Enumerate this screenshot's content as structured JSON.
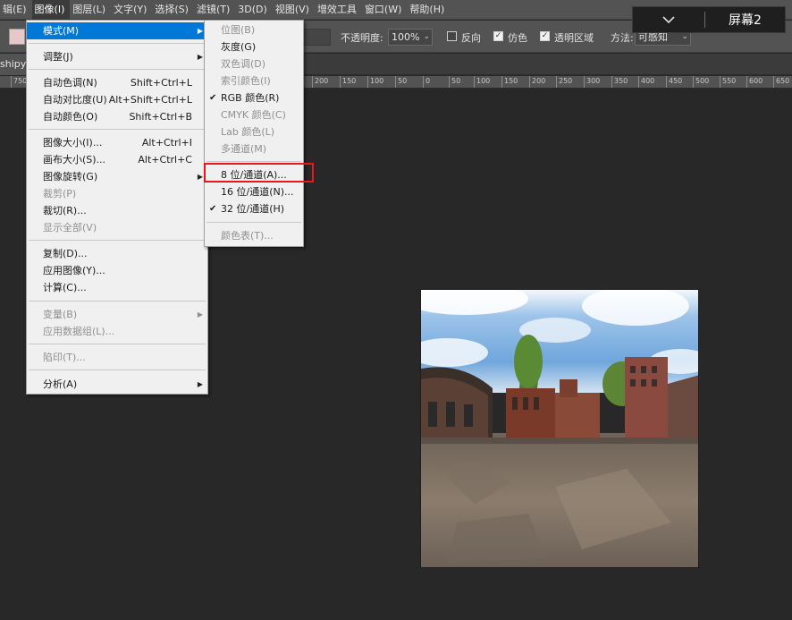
{
  "menubar": {
    "items": [
      "辑(E)",
      "图像(I)",
      "图层(L)",
      "文字(Y)",
      "选择(S)",
      "滤镜(T)",
      "3D(D)",
      "视图(V)",
      "增效工具",
      "窗口(W)",
      "帮助(H)"
    ]
  },
  "screen_badge": {
    "chevron_icon": "chevron-down-icon",
    "label": "屏幕2"
  },
  "options": {
    "opacity_label": "不透明度:",
    "opacity_value": "100%",
    "reverse_label": "反向",
    "dither_label": "仿色",
    "transparency_label": "透明区域",
    "method_label": "方法:",
    "method_value": "可感知",
    "dither_checked": true,
    "transparency_checked": true,
    "reverse_checked": false
  },
  "tab": {
    "title": "shipya"
  },
  "ruler": {
    "labels": [
      "750",
      "200",
      "150",
      "100",
      "50",
      "0",
      "50",
      "100",
      "150",
      "200",
      "250",
      "300",
      "350",
      "400",
      "450",
      "500",
      "550",
      "600",
      "650"
    ]
  },
  "image_menu": {
    "items": [
      {
        "label": "模式(M)",
        "shortcut": "",
        "submenu": true,
        "disabled": false,
        "highlighted": true
      },
      {
        "label": "调整(J)",
        "shortcut": "",
        "submenu": true,
        "disabled": false
      },
      {
        "label": "自动色调(N)",
        "shortcut": "Shift+Ctrl+L",
        "disabled": false
      },
      {
        "label": "自动对比度(U)",
        "shortcut": "Alt+Shift+Ctrl+L",
        "disabled": false
      },
      {
        "label": "自动颜色(O)",
        "shortcut": "Shift+Ctrl+B",
        "disabled": false
      },
      {
        "label": "图像大小(I)...",
        "shortcut": "Alt+Ctrl+I",
        "disabled": false
      },
      {
        "label": "画布大小(S)...",
        "shortcut": "Alt+Ctrl+C",
        "disabled": false
      },
      {
        "label": "图像旋转(G)",
        "shortcut": "",
        "submenu": true,
        "disabled": false
      },
      {
        "label": "裁剪(P)",
        "shortcut": "",
        "disabled": true
      },
      {
        "label": "裁切(R)...",
        "shortcut": "",
        "disabled": false
      },
      {
        "label": "显示全部(V)",
        "shortcut": "",
        "disabled": true
      },
      {
        "label": "复制(D)...",
        "shortcut": "",
        "disabled": false
      },
      {
        "label": "应用图像(Y)...",
        "shortcut": "",
        "disabled": false
      },
      {
        "label": "计算(C)...",
        "shortcut": "",
        "disabled": false
      },
      {
        "label": "变量(B)",
        "shortcut": "",
        "submenu": true,
        "disabled": true
      },
      {
        "label": "应用数据组(L)...",
        "shortcut": "",
        "disabled": true
      },
      {
        "label": "陷印(T)...",
        "shortcut": "",
        "disabled": true
      },
      {
        "label": "分析(A)",
        "shortcut": "",
        "submenu": true,
        "disabled": false
      }
    ]
  },
  "mode_submenu": {
    "items": [
      {
        "label": "位图(B)",
        "disabled": true,
        "checked": false
      },
      {
        "label": "灰度(G)",
        "disabled": false,
        "checked": false
      },
      {
        "label": "双色调(D)",
        "disabled": true,
        "checked": false
      },
      {
        "label": "索引颜色(I)",
        "disabled": true,
        "checked": false
      },
      {
        "label": "RGB 颜色(R)",
        "disabled": false,
        "checked": true
      },
      {
        "label": "CMYK 颜色(C)",
        "disabled": true,
        "checked": false
      },
      {
        "label": "Lab 颜色(L)",
        "disabled": true,
        "checked": false
      },
      {
        "label": "多通道(M)",
        "disabled": true,
        "checked": false
      },
      {
        "label": "8 位/通道(A)...",
        "disabled": false,
        "checked": false
      },
      {
        "label": "16 位/通道(N)...",
        "disabled": false,
        "checked": false
      },
      {
        "label": "32 位/通道(H)",
        "disabled": false,
        "checked": true
      },
      {
        "label": "颜色表(T)...",
        "disabled": true,
        "checked": false
      }
    ]
  },
  "colors": {
    "menu_highlight": "#0078d7",
    "annotation_box": "#e81818",
    "canvas_bg": "#282828"
  }
}
